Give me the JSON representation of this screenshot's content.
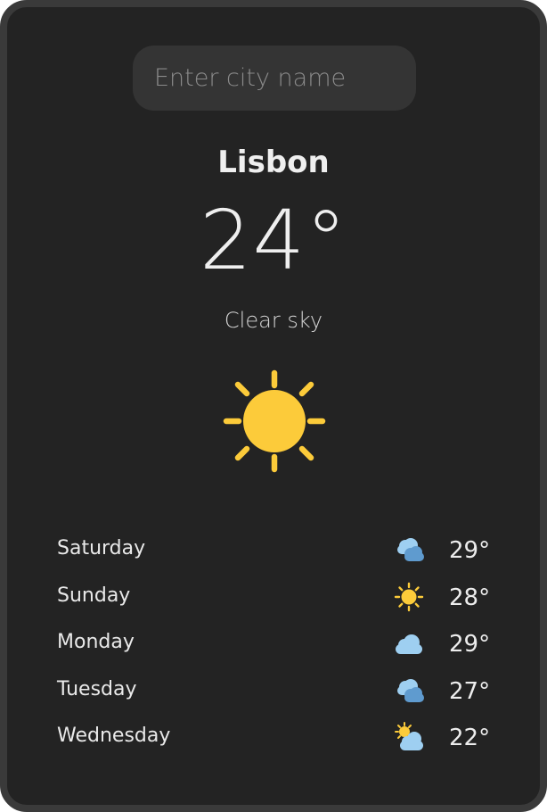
{
  "search": {
    "placeholder": "Enter city name",
    "value": ""
  },
  "current": {
    "city": "Lisbon",
    "temperature": "24°",
    "description": "Clear sky",
    "icon": "sun-icon"
  },
  "forecast": [
    {
      "day": "Saturday",
      "temp": "29°",
      "icon": "partly-cloudy-icon"
    },
    {
      "day": "Sunday",
      "temp": "28°",
      "icon": "sun-icon"
    },
    {
      "day": "Monday",
      "temp": "29°",
      "icon": "cloud-icon"
    },
    {
      "day": "Tuesday",
      "temp": "27°",
      "icon": "partly-cloudy-icon"
    },
    {
      "day": "Wednesday",
      "temp": "22°",
      "icon": "sun-behind-cloud-icon"
    }
  ],
  "colors": {
    "background": "#232323",
    "border": "#3a3a3a",
    "sun": "#fccb3a",
    "cloud_light": "#9ecff1",
    "cloud_dark": "#5f9bcf"
  }
}
